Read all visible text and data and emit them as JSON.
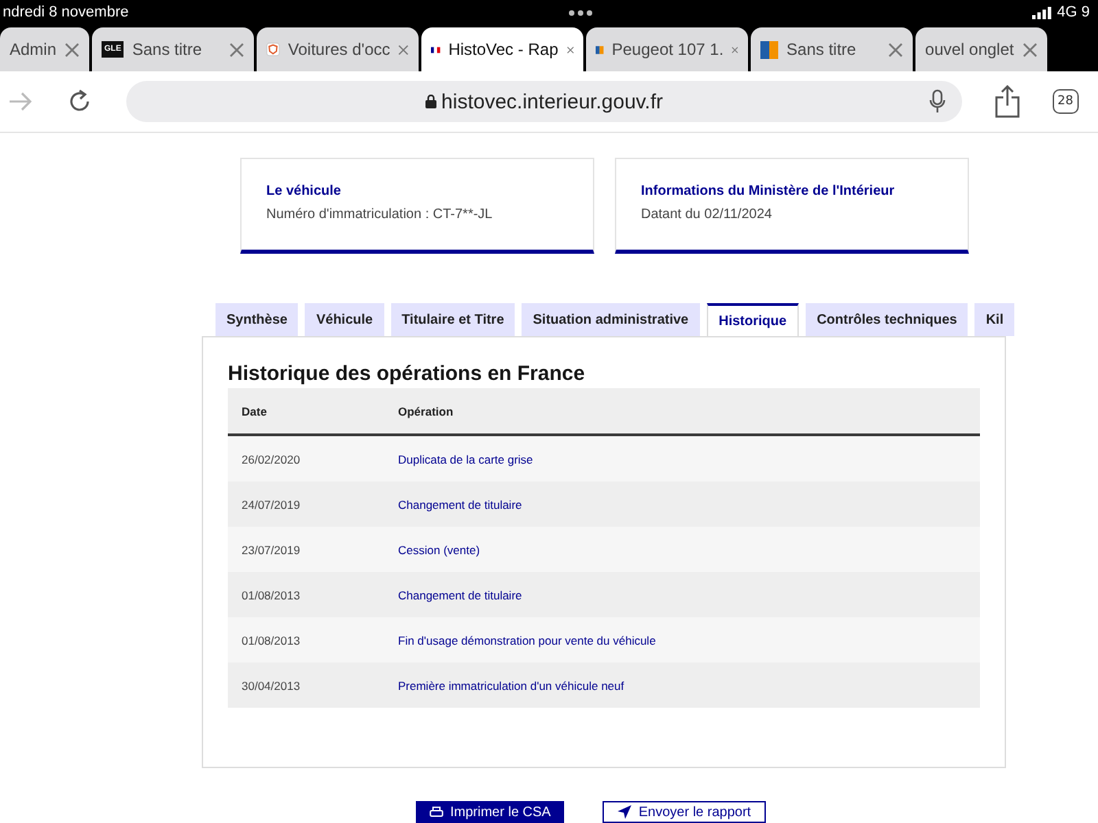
{
  "status_bar": {
    "date": "ndredi 8 novembre",
    "network": "4G 9"
  },
  "browser_tabs": [
    {
      "title": "Admin",
      "selected": false,
      "kind": "plain"
    },
    {
      "title": "Sans titre",
      "selected": false,
      "kind": "logo"
    },
    {
      "title": "Voitures d'occ",
      "selected": false,
      "kind": "shield"
    },
    {
      "title": "HistoVec - Rap",
      "selected": true,
      "kind": "flag"
    },
    {
      "title": "Peugeot 107 1.",
      "selected": false,
      "kind": "tile"
    },
    {
      "title": "Sans titre",
      "selected": false,
      "kind": "tile"
    },
    {
      "title": "ouvel onglet",
      "selected": false,
      "kind": "plain"
    }
  ],
  "gle_label": "GLE",
  "address_bar": {
    "url": "histovec.interieur.gouv.fr",
    "tab_count": "28"
  },
  "cards": [
    {
      "title": "Le véhicule",
      "text": "Numéro d'immatriculation : CT-7**-JL"
    },
    {
      "title": "Informations du Ministère de l'Intérieur",
      "text": "Datant du 02/11/2024"
    }
  ],
  "tabs": [
    {
      "label": "Synthèse",
      "selected": false
    },
    {
      "label": "Véhicule",
      "selected": false
    },
    {
      "label": "Titulaire et Titre",
      "selected": false
    },
    {
      "label": "Situation administrative",
      "selected": false
    },
    {
      "label": "Historique",
      "selected": true
    },
    {
      "label": "Contrôles techniques",
      "selected": false
    },
    {
      "label": "Kil",
      "selected": false
    }
  ],
  "panel": {
    "title": "Historique des opérations en France",
    "table": {
      "columns": [
        "Date",
        "Opération"
      ],
      "rows": [
        {
          "date": "26/02/2020",
          "operation": "Duplicata de la carte grise"
        },
        {
          "date": "24/07/2019",
          "operation": "Changement de titulaire"
        },
        {
          "date": "23/07/2019",
          "operation": "Cession (vente)"
        },
        {
          "date": "01/08/2013",
          "operation": "Changement de titulaire"
        },
        {
          "date": "01/08/2013",
          "operation": "Fin d'usage démonstration pour vente du véhicule"
        },
        {
          "date": "30/04/2013",
          "operation": "Première immatriculation d'un véhicule neuf"
        }
      ]
    }
  },
  "buttons": [
    {
      "label": "Imprimer le CSA",
      "kind": "primary"
    },
    {
      "label": "Envoyer le rapport",
      "kind": "secondary"
    }
  ]
}
